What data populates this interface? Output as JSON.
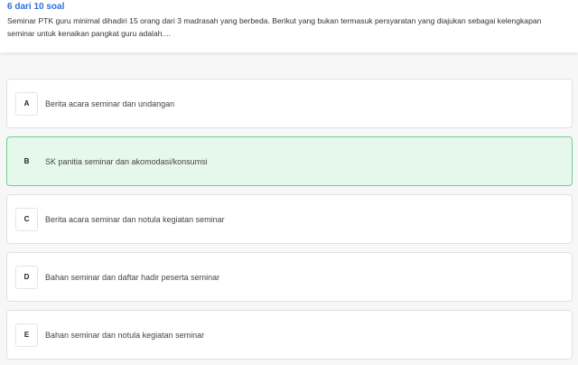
{
  "quiz": {
    "progress_label": "6 dari 10 soal",
    "question": "Seminar PTK guru minimal dihadiri 15 orang dari 3 madrasah yang berbeda. Berikut yang bukan termasuk persyaratan yang diajukan sebagai kelengkapan seminar untuk kenaikan pangkat guru adalah....",
    "selected_option": "B",
    "options": [
      {
        "letter": "A",
        "text": "Berita acara seminar dan undangan"
      },
      {
        "letter": "B",
        "text": "SK panitia seminar dan akomodasi/konsumsi"
      },
      {
        "letter": "C",
        "text": "Berita acara seminar dan notula kegiatan seminar"
      },
      {
        "letter": "D",
        "text": "Bahan seminar dan daftar hadir peserta seminar"
      },
      {
        "letter": "E",
        "text": "Bahan seminar dan notula kegiatan seminar"
      }
    ]
  },
  "colors": {
    "progress": "#2f6fd8",
    "selected_bg": "#e6f8ec",
    "selected_border": "#6fd08f"
  }
}
